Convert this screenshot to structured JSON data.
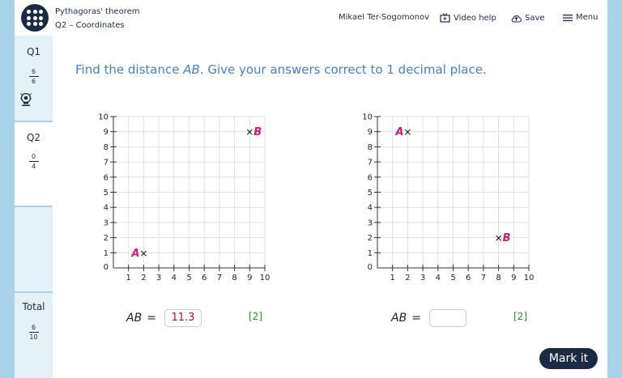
{
  "header": {
    "title": "Pythagoras' theorem",
    "subtitle": "Q2 – Coordinates",
    "user": "Mikael Ter-Sogomonov",
    "video_help": "Video help",
    "save": "Save",
    "menu": "Menu"
  },
  "sidebar": {
    "q1": {
      "label": "Q1",
      "score": "6",
      "total": "6"
    },
    "q2": {
      "label": "Q2",
      "score": "0",
      "total": "4"
    },
    "total": {
      "label": "Total",
      "score": "6",
      "total": "10"
    }
  },
  "question": {
    "prefix": "Find the distance ",
    "segment": "AB",
    "suffix": ". Give your answers correct to 1 decimal place."
  },
  "graphs": [
    {
      "points": [
        {
          "name": "A",
          "x": 2,
          "y": 1
        },
        {
          "name": "B",
          "x": 9,
          "y": 9
        }
      ]
    },
    {
      "points": [
        {
          "name": "A",
          "x": 2,
          "y": 9
        },
        {
          "name": "B",
          "x": 8,
          "y": 2
        }
      ]
    }
  ],
  "axis": {
    "min": 0,
    "max": 10
  },
  "answers": [
    {
      "label": "AB",
      "equals": "=",
      "value": "11.3",
      "marks": "[2]"
    },
    {
      "label": "AB",
      "equals": "=",
      "value": "",
      "marks": "[2]"
    }
  ],
  "actions": {
    "mark_it": "Mark it"
  },
  "colors": {
    "navy": "#1c2b45",
    "accent_blue": "#4a7fbf",
    "point_pink": "#d6177a",
    "marks_green": "#2a8a2a",
    "frame_blue": "#a8d3e8"
  }
}
